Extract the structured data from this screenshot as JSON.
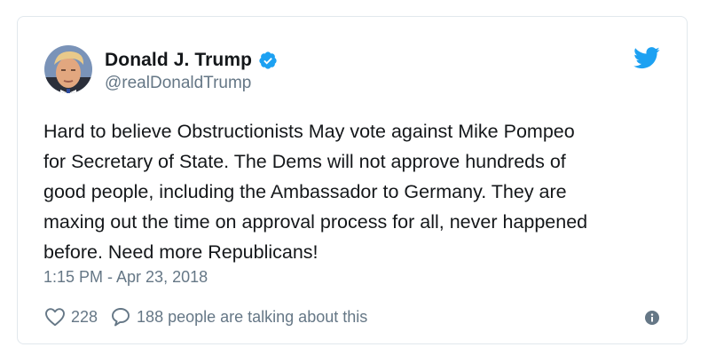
{
  "tweet": {
    "author": {
      "display_name": "Donald J. Trump",
      "handle": "@realDonaldTrump",
      "verified_icon": "verified-badge-icon"
    },
    "brand": {
      "icon": "twitter-bird-icon",
      "color": "#1da1f2"
    },
    "text_lines": [
      "Hard to believe Obstructionists May vote against Mike Pompeo",
      "for Secretary of State. The Dems will not approve hundreds of",
      "good people, including the Ambassador to Germany. They are",
      "maxing out the time on approval process for all, never happened",
      "before. Need more Republicans!"
    ],
    "timestamp": "1:15 PM - Apr 23, 2018",
    "likes": {
      "icon": "heart-icon",
      "count": "228"
    },
    "conversation": {
      "icon": "reply-bubble-icon",
      "label": "188 people are talking about this"
    },
    "info_icon": "info-icon"
  },
  "colors": {
    "text": "#14171a",
    "secondary_text": "#657786",
    "border": "#e1e8ed",
    "accent": "#1da1f2"
  }
}
